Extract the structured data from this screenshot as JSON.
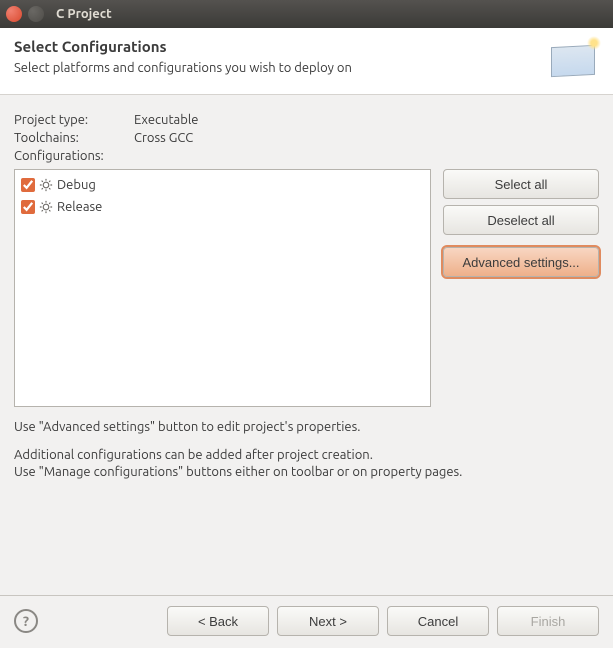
{
  "window": {
    "title": "C Project"
  },
  "banner": {
    "heading": "Select Configurations",
    "subheading": "Select platforms and configurations you wish to deploy on"
  },
  "info": {
    "project_type_label": "Project type:",
    "project_type_value": "Executable",
    "toolchains_label": "Toolchains:",
    "toolchains_value": "Cross GCC",
    "configurations_label": "Configurations:"
  },
  "configs": [
    {
      "name": "Debug",
      "checked": true
    },
    {
      "name": "Release",
      "checked": true
    }
  ],
  "buttons": {
    "select_all": "Select all",
    "deselect_all": "Deselect all",
    "advanced": "Advanced settings..."
  },
  "hint": {
    "line1": "Use \"Advanced settings\" button to edit project's properties.",
    "line2": "Additional configurations can be added after project creation.",
    "line3": "Use \"Manage configurations\" buttons either on toolbar or on property pages."
  },
  "footer": {
    "back": "< Back",
    "next": "Next >",
    "cancel": "Cancel",
    "finish": "Finish"
  }
}
